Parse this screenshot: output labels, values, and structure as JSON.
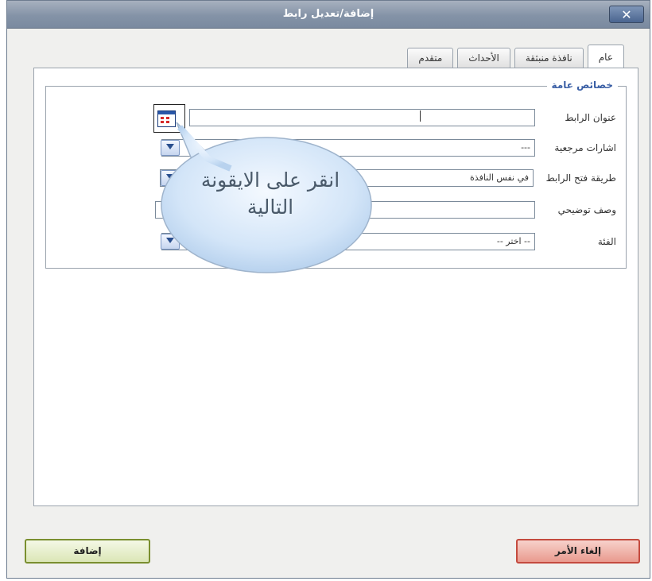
{
  "window": {
    "title": "إضافة/تعديل رابط",
    "close_label": "✕"
  },
  "tabs": [
    {
      "label": "عام",
      "active": true
    },
    {
      "label": "نافذة منبثقة",
      "active": false
    },
    {
      "label": "الأحداث",
      "active": false
    },
    {
      "label": "متقدم",
      "active": false
    }
  ],
  "fieldset": {
    "legend": "خصائص عامة",
    "fields": [
      {
        "label": "عنوان الرابط",
        "value": ""
      },
      {
        "label": "اشارات مرجعية",
        "value": "---"
      },
      {
        "label": "طريقة فتح الرابط",
        "value": "في نفس النافذة"
      },
      {
        "label": "وصف توضيحي",
        "value": ""
      },
      {
        "label": "الفئة",
        "value": "-- اختر --"
      }
    ]
  },
  "callout": {
    "line1": "انقر على الايقونة",
    "line2": "التالية"
  },
  "buttons": {
    "add_label": "إضافة",
    "cancel_label": "إلغاء الأمر"
  },
  "colors": {
    "titlebar": "#8493a7",
    "legend": "#3a5fa5",
    "add_border": "#7a8f2f",
    "cancel_border": "#c44b3f"
  }
}
